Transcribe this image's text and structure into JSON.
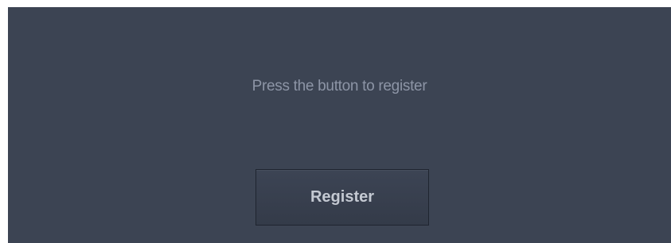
{
  "prompt": {
    "text": "Press the button to register"
  },
  "actions": {
    "register_label": "Register"
  },
  "colors": {
    "panel_background": "#3c4453",
    "prompt_text": "#8d95a6",
    "button_text": "#c4c9d2",
    "button_border": "#1f2530"
  }
}
